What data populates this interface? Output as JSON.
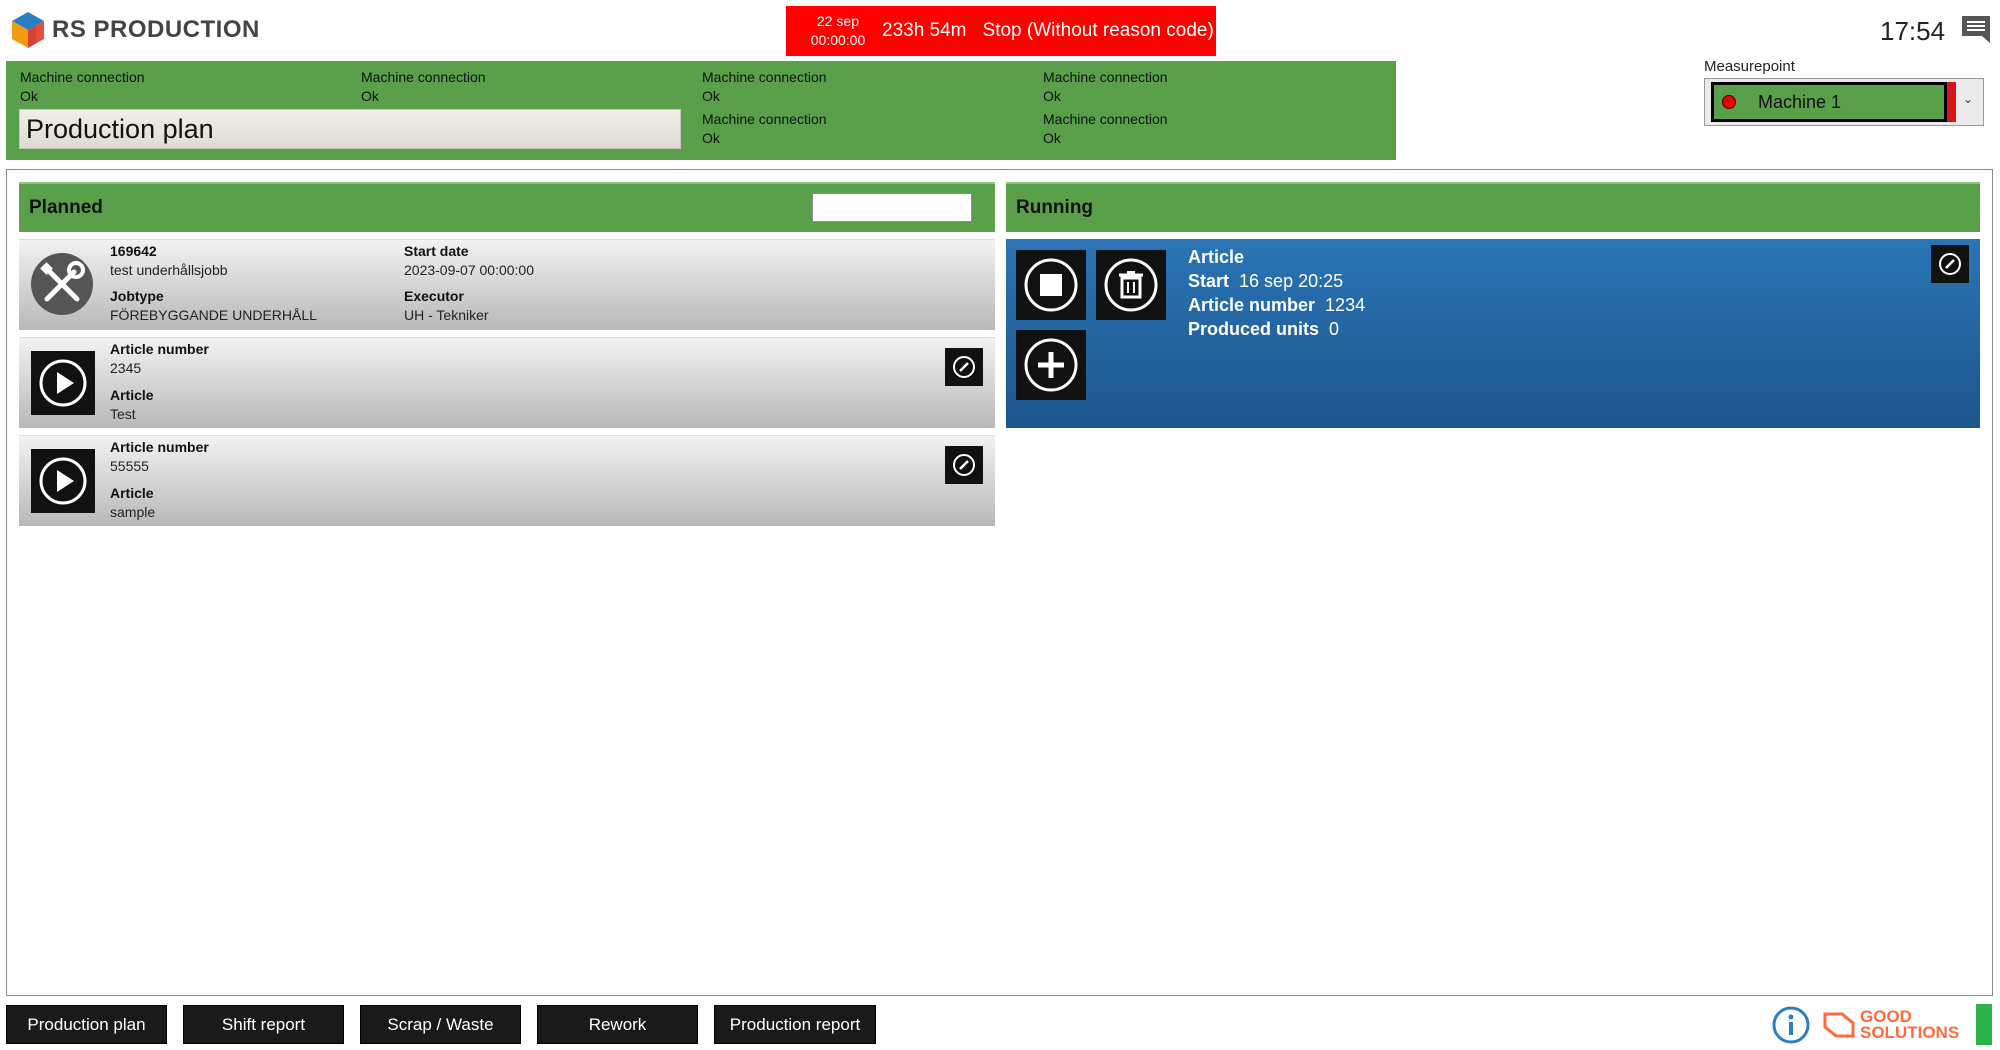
{
  "header": {
    "brand": "RS PRODUCTION",
    "alarm": {
      "date": "22 sep",
      "time": "00:00:00",
      "duration": "233h 54m",
      "reason": "Stop (Without reason code)"
    },
    "clock": "17:54"
  },
  "status_panel": {
    "title": "Production plan",
    "connections": [
      {
        "label": "Machine connection",
        "value": "Ok"
      },
      {
        "label": "Machine connection",
        "value": "Ok"
      },
      {
        "label": "Machine connection",
        "value": "Ok"
      },
      {
        "label": "Machine connection",
        "value": "Ok"
      },
      {
        "label": "Machine connection",
        "value": "Ok"
      },
      {
        "label": "Machine connection",
        "value": "Ok"
      }
    ]
  },
  "measurepoint": {
    "label": "Measurepoint",
    "selected": "Machine 1"
  },
  "planned": {
    "title": "Planned",
    "job": {
      "id": "169642",
      "name": "test underhållsjobb",
      "jobtype_label": "Jobtype",
      "jobtype": "FÖREBYGGANDE UNDERHÅLL",
      "start_label": "Start date",
      "start": "2023-09-07 00:00:00",
      "executor_label": "Executor",
      "executor": "UH - Tekniker"
    },
    "items": [
      {
        "artnum_label": "Article number",
        "artnum": "2345",
        "article_label": "Article",
        "article": "Test"
      },
      {
        "artnum_label": "Article number",
        "artnum": "55555",
        "article_label": "Article",
        "article": "sample"
      }
    ]
  },
  "running": {
    "title": "Running",
    "heading": "Article",
    "start_label": "Start",
    "start": "16 sep 20:25",
    "artnum_label": "Article number",
    "artnum": "1234",
    "units_label": "Produced units",
    "units": "0"
  },
  "footer": {
    "buttons": [
      "Production plan",
      "Shift report",
      "Scrap / Waste",
      "Rework",
      "Production report"
    ],
    "brand_line1": "GOOD",
    "brand_line2": "SOLUTIONS"
  },
  "colors": {
    "green": "#5aa04b",
    "alarm_red": "#ff0000",
    "running_blue": "#2a75b6"
  }
}
